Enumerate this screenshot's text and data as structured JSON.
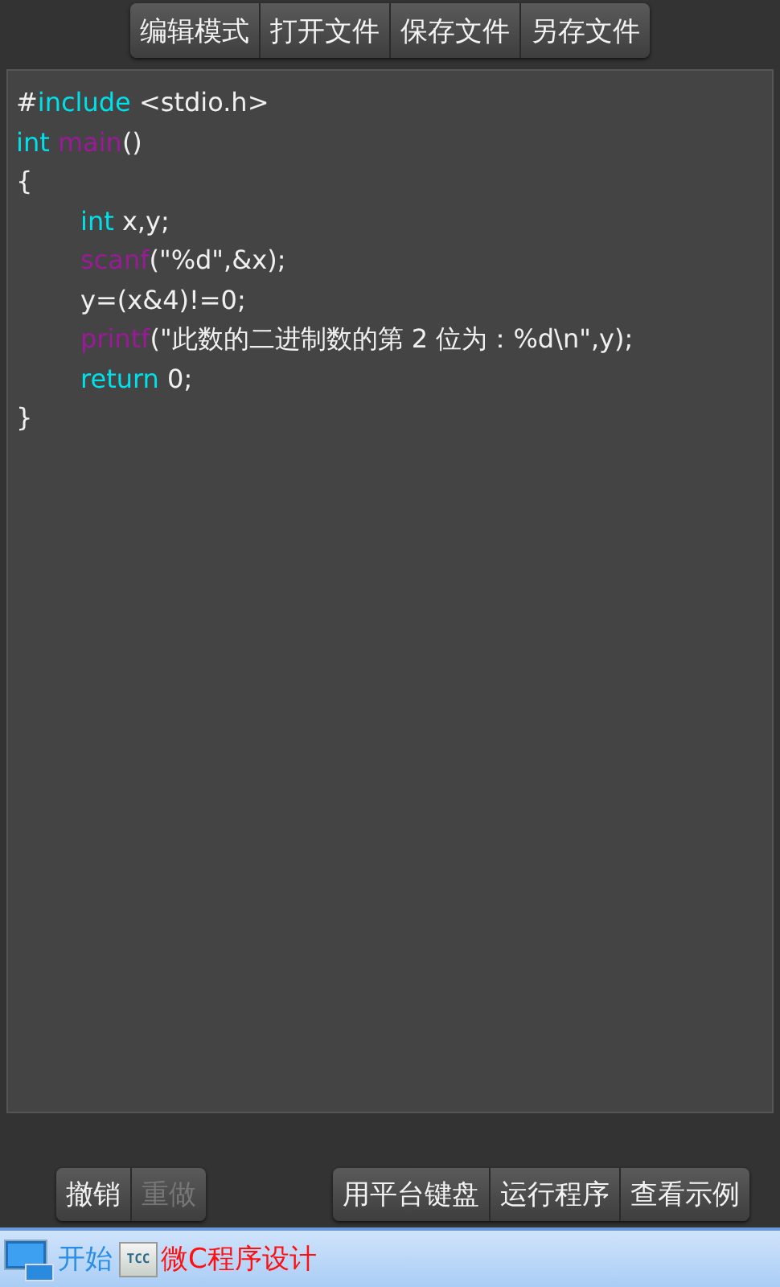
{
  "toolbar": [
    {
      "label": "编辑模式"
    },
    {
      "label": "打开文件"
    },
    {
      "label": "保存文件"
    },
    {
      "label": "另存文件"
    }
  ],
  "code_lines": [
    {
      "indented": false,
      "tokens": [
        {
          "kind": "plain",
          "text": "#"
        },
        {
          "kind": "keyword",
          "text": "include"
        },
        {
          "kind": "plain",
          "text": " <stdio.h>"
        }
      ]
    },
    {
      "indented": false,
      "tokens": [
        {
          "kind": "keyword",
          "text": "int"
        },
        {
          "kind": "function",
          "text": "main"
        },
        {
          "kind": "plain",
          "text": "()"
        }
      ]
    },
    {
      "indented": false,
      "tokens": [
        {
          "kind": "plain",
          "text": "{"
        }
      ]
    },
    {
      "indented": true,
      "tokens": [
        {
          "kind": "keyword",
          "text": "int"
        },
        {
          "kind": "plain",
          "text": " x,y;"
        }
      ]
    },
    {
      "indented": true,
      "tokens": [
        {
          "kind": "function",
          "text": "scanf"
        },
        {
          "kind": "plain",
          "text": "(\"%d\",&x);"
        }
      ]
    },
    {
      "indented": true,
      "tokens": [
        {
          "kind": "plain",
          "text": "y=(x&4)!=0;"
        }
      ]
    },
    {
      "indented": true,
      "tokens": [
        {
          "kind": "function",
          "text": "printf"
        },
        {
          "kind": "plain",
          "text": "(\"此数的二进制数的第 2 位为：%d\\n\",y);"
        }
      ]
    },
    {
      "indented": true,
      "tokens": [
        {
          "kind": "keyword",
          "text": "return"
        },
        {
          "kind": "plain",
          "text": " 0;"
        }
      ]
    },
    {
      "indented": false,
      "tokens": [
        {
          "kind": "plain",
          "text": "}"
        }
      ]
    }
  ],
  "edit_buttons": [
    {
      "label": "撤销",
      "disabled": false
    },
    {
      "label": "重做",
      "disabled": true
    }
  ],
  "action_buttons": [
    {
      "label": "用平台键盘"
    },
    {
      "label": "运行程序"
    },
    {
      "label": "查看示例"
    }
  ],
  "taskbar": {
    "start_label": "开始",
    "app_icon_text": "TCC",
    "app_title": "微C程序设计"
  }
}
